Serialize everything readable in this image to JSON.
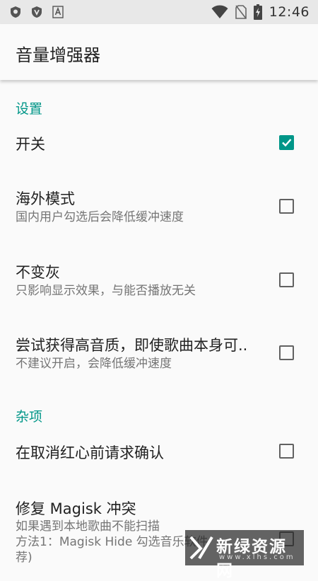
{
  "status_bar": {
    "time": "12:46",
    "left_icons": [
      "shield-icon",
      "shield-icon",
      "font-icon"
    ],
    "right_icons": [
      "wifi-icon",
      "no-sim-icon",
      "battery-charging-icon"
    ]
  },
  "app_bar": {
    "title": "音量增强器"
  },
  "sections": [
    {
      "header": "设置",
      "items": [
        {
          "label": "开关",
          "summary": "",
          "checked": true
        },
        {
          "label": "海外模式",
          "summary": "国内用户勾选后会降低缓冲速度",
          "checked": false
        },
        {
          "label": "不变灰",
          "summary": "只影响显示效果，与能否播放无关",
          "checked": false
        },
        {
          "label": "尝试获得高音质，即使歌曲本身可..",
          "summary": "不建议开启，会降低缓冲速度",
          "checked": false
        }
      ]
    },
    {
      "header": "杂项",
      "items": [
        {
          "label": "在取消红心前请求确认",
          "summary": "",
          "checked": false
        },
        {
          "label": "修复 Magisk 冲突",
          "summary_lines": [
            "如果遇到本地歌曲不能扫描",
            "方法1：Magisk Hide 勾选音乐软件",
            "荐)"
          ],
          "checked": false
        }
      ]
    }
  ],
  "watermark": {
    "title": "新绿资源网",
    "url": "www.xlhs.com"
  },
  "colors": {
    "accent": "#009688",
    "status_bar": "#e8e8e8",
    "background": "#fafafa"
  }
}
